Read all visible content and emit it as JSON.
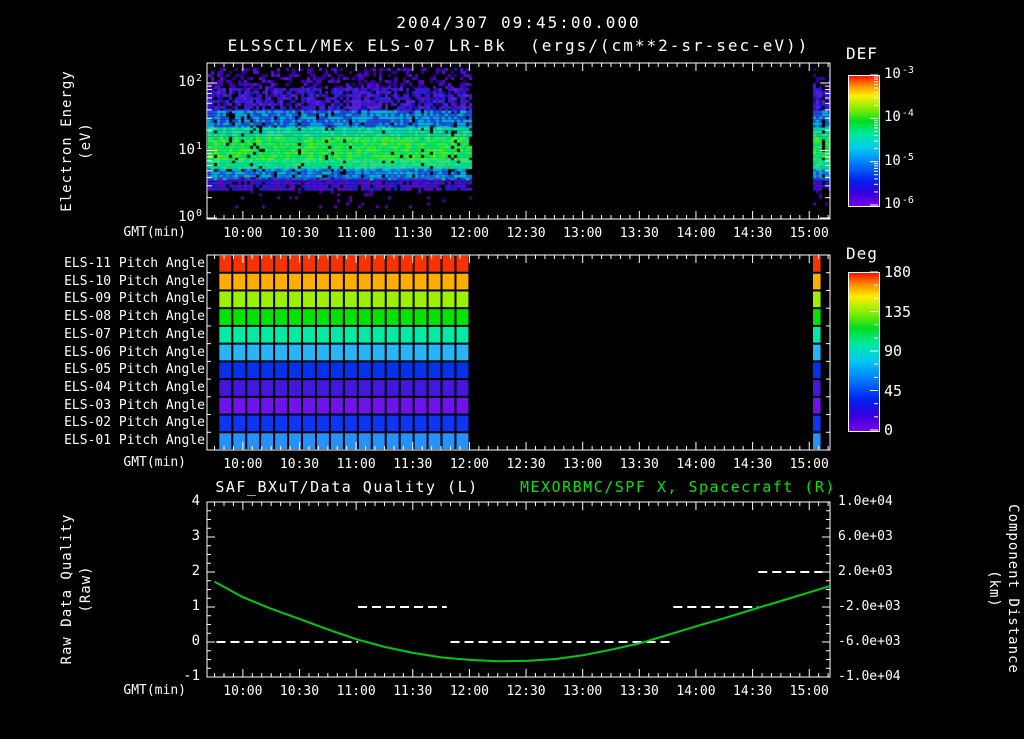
{
  "header": {
    "line1": "2004/307 09:45:00.000",
    "line2": "ELSSCIL/MEx ELS-07 LR-Bk  (ergs/(cm**2-sr-sec-eV))"
  },
  "time_axis": {
    "label": "GMT(min)",
    "domain": [
      "09:41",
      "15:11"
    ],
    "major_ticks": [
      "10:00",
      "10:30",
      "11:00",
      "11:30",
      "12:00",
      "12:30",
      "13:00",
      "13:30",
      "14:00",
      "14:30",
      "15:00"
    ],
    "minor_step_min": 5
  },
  "colors": {
    "background": "#000000",
    "foreground": "#ffffff",
    "accent_green": "#00e400",
    "curve_green": "#00c814",
    "rainbow_bottom_to_top": [
      "#7a00e8",
      "#3300dd",
      "#0022ee",
      "#0077ff",
      "#00ccee",
      "#00e8a0",
      "#00dd22",
      "#88ee00",
      "#ffee00",
      "#ff8800",
      "#ff1100"
    ]
  },
  "chart_data": [
    {
      "id": "electron_energy_spectrogram",
      "type": "heatmap",
      "ylabel": "Electron Energy",
      "ylabel2": "(eV)",
      "y_scale": "log",
      "y_ticks": [
        {
          "base": "10",
          "exp": "2"
        },
        {
          "base": "10",
          "exp": "1"
        },
        {
          "base": "10",
          "exp": "0"
        }
      ],
      "colorbar": {
        "title": "DEF",
        "ticks": [
          {
            "base": "10",
            "exp": "-3"
          },
          {
            "base": "10",
            "exp": "-4"
          },
          {
            "base": "10",
            "exp": "-5"
          },
          {
            "base": "10",
            "exp": "-6"
          }
        ]
      },
      "data_segments": [
        {
          "start": "09:41",
          "end": "12:00"
        },
        {
          "start": "15:02",
          "end": "15:10"
        }
      ],
      "bands": [
        {
          "y0": 0.026,
          "y1": 0.155,
          "density": 0.42,
          "colors": [
            "#4a00c8",
            "#3600aa",
            "#2c0090",
            "#5a10d8"
          ]
        },
        {
          "y0": 0.155,
          "y1": 0.3,
          "density": 0.8,
          "colors": [
            "#3a14cc",
            "#2a20d8",
            "#4c14c4",
            "#2010a0",
            "#5520dd"
          ]
        },
        {
          "y0": 0.3,
          "y1": 0.41,
          "density": 0.96,
          "colors": [
            "#1a54e4",
            "#10a0ec",
            "#00b8dc",
            "#2244dc"
          ]
        },
        {
          "y0": 0.41,
          "y1": 0.47,
          "density": 0.98,
          "colors": [
            "#00dcb0",
            "#00d890",
            "#28e8a4"
          ]
        },
        {
          "y0": 0.47,
          "y1": 0.62,
          "density": 0.99,
          "colors": [
            "#22ee3c",
            "#00e464",
            "#58f01c",
            "#00e08c",
            "#30ec50"
          ]
        },
        {
          "y0": 0.62,
          "y1": 0.675,
          "density": 0.98,
          "colors": [
            "#00dc9c",
            "#00e074",
            "#30e084"
          ]
        },
        {
          "y0": 0.675,
          "y1": 0.74,
          "density": 0.95,
          "colors": [
            "#00a8e4",
            "#1874ec",
            "#00c0d4",
            "#2050dc"
          ]
        },
        {
          "y0": 0.74,
          "y1": 0.815,
          "density": 0.82,
          "colors": [
            "#3014d4",
            "#4c10cc",
            "#6408c8",
            "#1820cc"
          ]
        },
        {
          "y0": 0.815,
          "y1": 0.93,
          "density": 0.06,
          "colors": [
            "#5800b8",
            "#4a00a0"
          ]
        }
      ]
    },
    {
      "id": "pitch_angle_panel",
      "type": "heatmap",
      "rows": [
        {
          "label": "ELS-11 Pitch Angle",
          "angle_deg": 176,
          "color": "#fa3200"
        },
        {
          "label": "ELS-10 Pitch Angle",
          "angle_deg": 152,
          "color": "#ffae00"
        },
        {
          "label": "ELS-09 Pitch Angle",
          "angle_deg": 128,
          "color": "#9cf000"
        },
        {
          "label": "ELS-08 Pitch Angle",
          "angle_deg": 104,
          "color": "#00e400"
        },
        {
          "label": "ELS-07 Pitch Angle",
          "angle_deg": 88,
          "color": "#00eca4"
        },
        {
          "label": "ELS-06 Pitch Angle",
          "angle_deg": 66,
          "color": "#28b4f6"
        },
        {
          "label": "ELS-05 Pitch Angle",
          "angle_deg": 38,
          "color": "#0432e8"
        },
        {
          "label": "ELS-04 Pitch Angle",
          "angle_deg": 18,
          "color": "#4418dc"
        },
        {
          "label": "ELS-03 Pitch Angle",
          "angle_deg": 8,
          "color": "#7012ec"
        },
        {
          "label": "ELS-02 Pitch Angle",
          "angle_deg": 34,
          "color": "#0e34f4"
        },
        {
          "label": "ELS-01 Pitch Angle",
          "angle_deg": 58,
          "color": "#2492fa"
        }
      ],
      "colorbar": {
        "title": "Deg",
        "ticks": [
          180,
          135,
          90,
          45,
          0
        ]
      },
      "data_segments": [
        {
          "start": "09:47",
          "end": "12:00"
        },
        {
          "start": "15:02",
          "end": "15:06"
        }
      ],
      "grid_columns": 18
    },
    {
      "id": "quality_distance_panel",
      "type": "line",
      "title_left": "SAF_BXuT/Data Quality (L)",
      "title_right": "MEXORBMC/SPF X, Spacecraft (R)",
      "ylabel_left": "Raw Data Quality",
      "ylabel_left2": "(Raw)",
      "ylabel_right": "Component Distance",
      "ylabel_right2": "(km)",
      "y_left_ticks": [
        4,
        3,
        2,
        1,
        0,
        -1
      ],
      "y_left_range": [
        -1,
        4
      ],
      "y_right_ticks": [
        "1.0e+04",
        "6.0e+03",
        "2.0e+03",
        "-2.0e+03",
        "-6.0e+03",
        "-1.0e+04"
      ],
      "y_right_range": [
        -10000,
        10000
      ],
      "series": [
        {
          "name": "SAF_BXuT/Data Quality",
          "style": "dashed_white",
          "segments": [
            {
              "value": 0,
              "start": "09:46",
              "end": "11:01"
            },
            {
              "value": 1,
              "start": "11:01",
              "end": "11:48"
            },
            {
              "value": 0,
              "start": "11:50",
              "end": "13:47"
            },
            {
              "value": 1,
              "start": "13:48",
              "end": "14:33"
            },
            {
              "value": 2,
              "start": "14:33",
              "end": "15:07"
            }
          ]
        },
        {
          "name": "MEXORBMC/SPF X Spacecraft",
          "style": "solid_green",
          "color": "#00c814",
          "points": [
            [
              "09:45",
              1.72
            ],
            [
              "10:00",
              1.28
            ],
            [
              "10:15",
              0.95
            ],
            [
              "10:30",
              0.66
            ],
            [
              "10:45",
              0.36
            ],
            [
              "11:00",
              0.08
            ],
            [
              "11:15",
              -0.14
            ],
            [
              "11:30",
              -0.31
            ],
            [
              "11:45",
              -0.44
            ],
            [
              "12:00",
              -0.51
            ],
            [
              "12:15",
              -0.55
            ],
            [
              "12:30",
              -0.54
            ],
            [
              "12:45",
              -0.49
            ],
            [
              "13:00",
              -0.38
            ],
            [
              "13:15",
              -0.22
            ],
            [
              "13:30",
              -0.04
            ],
            [
              "13:45",
              0.2
            ],
            [
              "14:00",
              0.45
            ],
            [
              "14:15",
              0.68
            ],
            [
              "14:30",
              0.93
            ],
            [
              "14:45",
              1.17
            ],
            [
              "15:00",
              1.42
            ],
            [
              "15:11",
              1.6
            ]
          ]
        }
      ]
    }
  ]
}
